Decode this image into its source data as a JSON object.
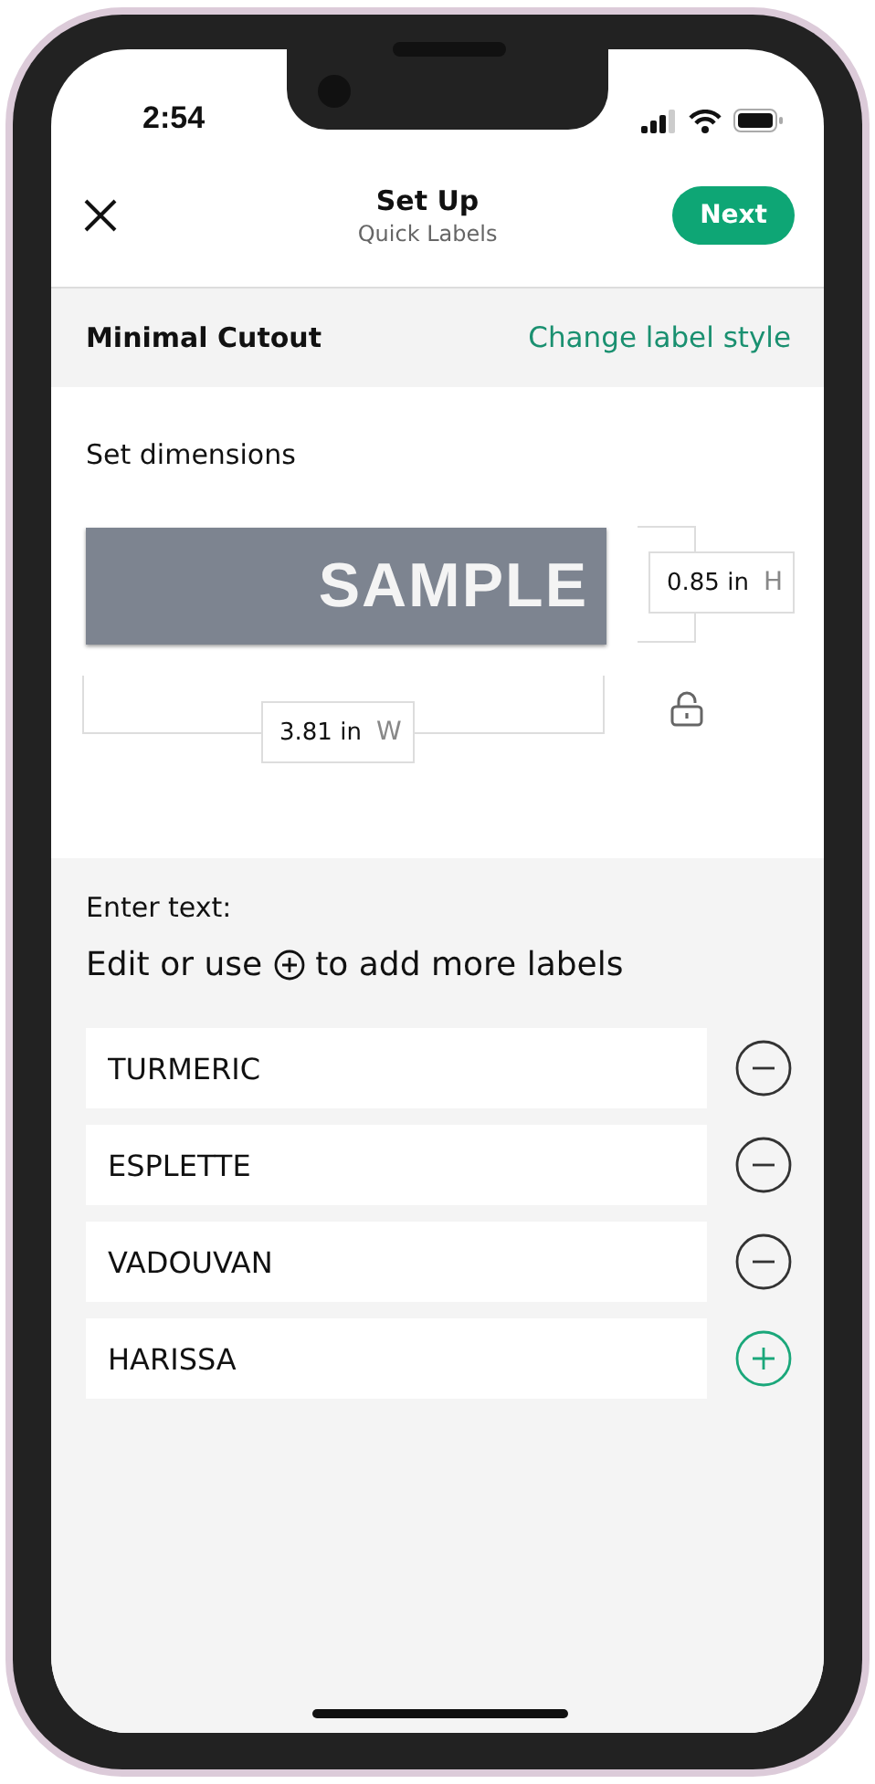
{
  "status_bar": {
    "time": "2:54"
  },
  "header": {
    "title": "Set Up",
    "subtitle": "Quick Labels",
    "next_button": "Next"
  },
  "style_bar": {
    "style_name": "Minimal Cutout",
    "change_link": "Change label style"
  },
  "dimensions": {
    "heading": "Set dimensions",
    "preview_text": "SAMPLE",
    "height_value": "0.85 in",
    "height_unit": "H",
    "width_value": "3.81 in",
    "width_unit": "W"
  },
  "text_section": {
    "heading": "Enter text:",
    "instruction_before": "Edit or use",
    "instruction_after": "to add more labels"
  },
  "labels": [
    {
      "value": "TURMERIC",
      "kind": "remove"
    },
    {
      "value": "ESPLETTE",
      "kind": "remove"
    },
    {
      "value": "VADOUVAN",
      "kind": "remove"
    },
    {
      "value": "HARISSA",
      "kind": "add"
    }
  ]
}
